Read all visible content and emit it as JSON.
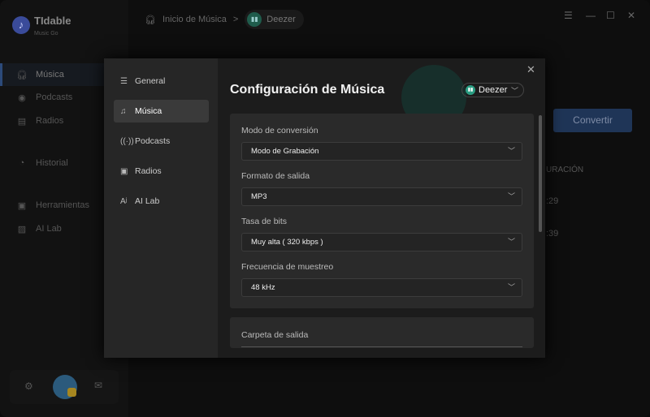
{
  "app": {
    "name": "TIdable",
    "subtitle": "Music Go",
    "logo_icon": "music-note-logo"
  },
  "sidebar": {
    "items": [
      {
        "label": "Música",
        "icon": "headphones-icon",
        "active": true
      },
      {
        "label": "Podcasts",
        "icon": "podcast-icon"
      },
      {
        "label": "Radios",
        "icon": "radio-icon"
      },
      {
        "label": "Historial",
        "icon": "clock-icon"
      },
      {
        "label": "Herramientas",
        "icon": "toolbox-icon"
      },
      {
        "label": "AI Lab",
        "icon": "image-icon"
      }
    ]
  },
  "breadcrumb": {
    "home": "Inicio de Música",
    "separator": ">",
    "current": "Deezer"
  },
  "main": {
    "convert_label": "Convertir",
    "col_header_partial": "URACIÓN",
    "dur1_partial": ":29",
    "dur2_partial": ":39"
  },
  "modal": {
    "nav": [
      {
        "label": "General",
        "icon": "sliders-icon"
      },
      {
        "label": "Música",
        "icon": "music-note-icon",
        "active": true
      },
      {
        "label": "Podcasts",
        "icon": "podcast-icon"
      },
      {
        "label": "Radios",
        "icon": "radio-icon"
      },
      {
        "label": "AI Lab",
        "icon": "ai-icon"
      }
    ],
    "title": "Configuración de Música",
    "service": "Deezer",
    "fields": [
      {
        "label": "Modo de conversión",
        "value": "Modo de Grabación"
      },
      {
        "label": "Formato de salida",
        "value": "MP3"
      },
      {
        "label": "Tasa de bits",
        "value": "Muy alta ( 320 kbps )"
      },
      {
        "label": "Frecuencia de muestreo",
        "value": "48 kHz"
      }
    ],
    "output_folder_label": "Carpeta de salida"
  },
  "colors": {
    "accent": "#1f3557",
    "deezer": "#2a9d82"
  }
}
